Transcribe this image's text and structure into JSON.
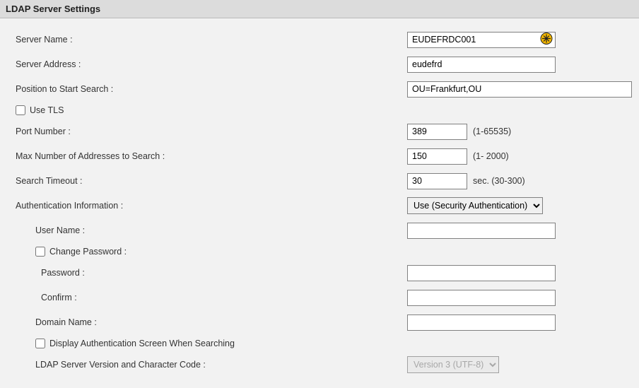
{
  "header": {
    "title": "LDAP Server Settings"
  },
  "labels": {
    "server_name": "Server Name   :",
    "server_address": "Server Address :",
    "position_start": "Position to Start Search   :",
    "use_tls": "Use TLS",
    "port_number": "Port Number :",
    "port_hint": "(1-65535)",
    "max_addresses": "Max Number of Addresses to Search :",
    "max_hint": "(1- 2000)",
    "search_timeout": "Search Timeout :",
    "timeout_hint": "sec. (30-300)",
    "auth_info": "Authentication Information :",
    "user_name": "User Name   :",
    "change_password": "Change Password :",
    "password": "Password :",
    "confirm": "Confirm :",
    "domain_name": "Domain Name :",
    "display_auth_screen": "Display Authentication Screen When Searching",
    "ldap_version": "LDAP Server Version and Character Code :"
  },
  "values": {
    "server_name": "EUDEFRDC001",
    "server_address": "eudefrd",
    "position_start": "OU=Frankfurt,OU",
    "use_tls": false,
    "port_number": "389",
    "max_addresses": "150",
    "search_timeout": "30",
    "auth_select": "Use (Security Authentication)",
    "user_name": "",
    "change_password": false,
    "password": "",
    "confirm": "",
    "domain_name": "",
    "display_auth_screen": false,
    "ldap_version": "Version 3 (UTF-8)"
  }
}
